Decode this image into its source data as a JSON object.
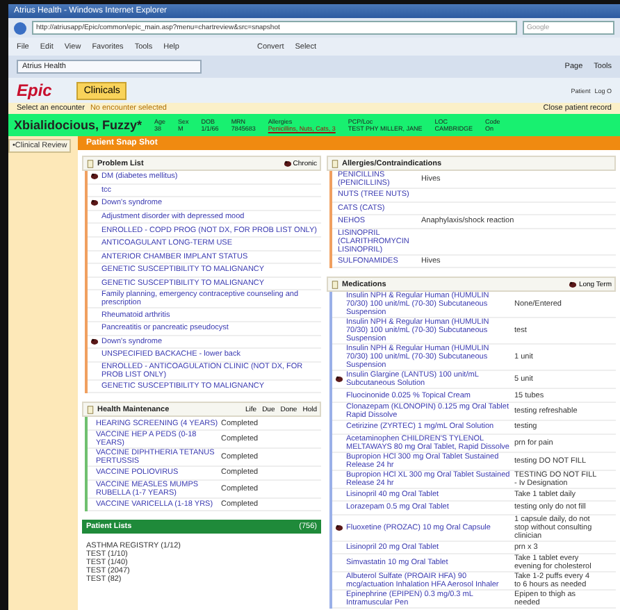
{
  "window": {
    "title": "Atrius Health - Windows Internet Explorer"
  },
  "browser": {
    "url": "http://atriusapp/Epic/common/epic_main.asp?menu=chartreview&src=snapshot",
    "search_placeholder": "Google",
    "menu": [
      "File",
      "Edit",
      "View",
      "Favorites",
      "Tools",
      "Help"
    ],
    "toolbar": [
      "Convert",
      "Select"
    ],
    "tab": "Atrius Health",
    "commands": [
      "Page",
      "Tools"
    ]
  },
  "epic": {
    "logo": "Epic",
    "activity": "Clinicals",
    "right_buttons": [
      "Patient",
      "Log O"
    ]
  },
  "encounter": {
    "label": "Select an encounter",
    "status": "No encounter selected",
    "close": "Close patient record"
  },
  "banner": {
    "name": "Xbialidocious, Fuzzy*",
    "fields": [
      {
        "label": "Age",
        "value": "38"
      },
      {
        "label": "Sex",
        "value": "M"
      },
      {
        "label": "DOB",
        "value": "1/1/66"
      },
      {
        "label": "MRN",
        "value": "7845683"
      },
      {
        "label": "Allergies",
        "value": "Penicillins, Nuts, Cats, 3",
        "alert": true
      },
      {
        "label": "PCP/Loc",
        "value": "TEST PHY MILLER, JANE",
        "alert": false
      },
      {
        "label": "LOC",
        "value": "CAMBRIDGE",
        "alert": false
      },
      {
        "label": "Code",
        "value": "On",
        "alert": false
      }
    ]
  },
  "sidebar": {
    "items": [
      {
        "label": "•Clinical Review",
        "selected": true
      }
    ]
  },
  "section_title": "Patient Snap Shot",
  "problem_list": {
    "title": "Problem List",
    "action": "Chronic",
    "items": [
      {
        "text": "DM (diabetes mellitus)",
        "chronic": true
      },
      {
        "text": "tcc",
        "chronic": false
      },
      {
        "text": "Down's syndrome",
        "chronic": true
      },
      {
        "text": "Adjustment disorder with depressed mood",
        "chronic": false
      },
      {
        "text": "ENROLLED - COPD PROG (NOT DX, FOR PROB LIST ONLY)",
        "chronic": false
      },
      {
        "text": "ANTICOAGULANT LONG-TERM USE",
        "chronic": false
      },
      {
        "text": "ANTERIOR CHAMBER IMPLANT STATUS",
        "chronic": false
      },
      {
        "text": "GENETIC SUSCEPTIBILITY TO MALIGNANCY",
        "chronic": false
      },
      {
        "text": "GENETIC SUSCEPTIBILITY TO MALIGNANCY",
        "chronic": false
      },
      {
        "text": "Family planning, emergency contraceptive counseling and prescription",
        "chronic": false
      },
      {
        "text": "Rheumatoid arthritis",
        "chronic": false
      },
      {
        "text": "Pancreatitis or pancreatic pseudocyst",
        "chronic": false
      },
      {
        "text": "Down's syndrome",
        "chronic": true
      },
      {
        "text": "UNSPECIFIED BACKACHE - lower back",
        "chronic": false
      },
      {
        "text": "ENROLLED - ANTICOAGULATION CLINIC (NOT DX, FOR PROB LIST ONLY)",
        "chronic": false
      },
      {
        "text": "GENETIC SUSCEPTIBILITY TO MALIGNANCY",
        "chronic": false
      }
    ]
  },
  "allergies": {
    "title": "Allergies/Contraindications",
    "items": [
      {
        "name": "PENICILLINS (PENICILLINS)",
        "reaction": "Hives"
      },
      {
        "name": "NUTS (TREE NUTS)"
      },
      {
        "name": "CATS (CATS)"
      },
      {
        "name": "NEHOS",
        "reaction": "Anaphylaxis/shock reaction"
      },
      {
        "name": "LISINOPRIL (CLARITHROMYCIN LISINOPRIL)"
      },
      {
        "name": "SULFONAMIDES",
        "reaction": "Hives"
      }
    ]
  },
  "medications": {
    "title": "Medications",
    "action": "Long Term",
    "items": [
      {
        "name": "Insulin NPH & Regular Human (HUMULIN 70/30) 100 unit/mL (70-30) Subcutaneous Suspension",
        "sig": "None/Entered",
        "long_term": false
      },
      {
        "name": "Insulin NPH & Regular Human (HUMULIN 70/30) 100 unit/mL (70-30) Subcutaneous Suspension",
        "sig": "test",
        "long_term": false
      },
      {
        "name": "Insulin NPH & Regular Human (HUMULIN 70/30) 100 unit/mL (70-30) Subcutaneous Suspension",
        "sig": "1 unit",
        "long_term": false
      },
      {
        "name": "Insulin Glargine (LANTUS) 100 unit/mL Subcutaneous Solution",
        "sig": "5 unit",
        "long_term": true
      },
      {
        "name": "Fluocinonide 0.025 % Topical Cream",
        "sig": "15 tubes",
        "long_term": false
      },
      {
        "name": "Clonazepam (KLONOPIN) 0.125 mg Oral Tablet Rapid Dissolve",
        "sig": "testing refreshable",
        "long_term": false
      },
      {
        "name": "Cetirizine (ZYRTEC) 1 mg/mL Oral Solution",
        "sig": "testing",
        "long_term": false
      },
      {
        "name": "Acetaminophen CHILDREN'S TYLENOL MELTAWAYS 80 mg Oral Tablet, Rapid Dissolve",
        "sig": "prn for pain",
        "long_term": false
      },
      {
        "name": "Bupropion HCl 300 mg Oral Tablet Sustained Release 24 hr",
        "sig": "testing DO NOT FILL",
        "long_term": false
      },
      {
        "name": "Bupropion HCl XL 300 mg Oral Tablet Sustained Release 24 hr",
        "sig": "TESTING DO NOT FILL - Iv Designation",
        "long_term": false
      },
      {
        "name": "Lisinopril 40 mg Oral Tablet",
        "sig": "Take 1 tablet daily",
        "long_term": false
      },
      {
        "name": "Lorazepam 0.5 mg Oral Tablet",
        "sig": "testing only do not fill",
        "long_term": false
      },
      {
        "name": "Fluoxetine (PROZAC) 10 mg Oral Capsule",
        "sig": "1 capsule daily, do not stop without consulting clinician",
        "long_term": true
      },
      {
        "name": "Lisinopril 20 mg Oral Tablet",
        "sig": "prn x 3",
        "long_term": false
      },
      {
        "name": "Simvastatin 10 mg Oral Tablet",
        "sig": "Take 1 tablet every evening for cholesterol",
        "long_term": false
      },
      {
        "name": "Albuterol Sulfate (PROAIR HFA) 90 mcg/actuation Inhalation HFA Aerosol Inhaler",
        "sig": "Take 1-2 puffs every 4 to 6 hours as needed",
        "long_term": false
      },
      {
        "name": "Epinephrine (EPIPEN) 0.3 mg/0.3 mL Intramuscular Pen",
        "sig": "Epipen to thigh as needed",
        "long_term": false
      }
    ]
  },
  "health_maintenance": {
    "title": "Health Maintenance",
    "actions": [
      "Life",
      "Due",
      "Done",
      "Hold"
    ],
    "items": [
      {
        "topic": "HEARING SCREENING (4 YEARS)",
        "status": "Completed"
      },
      {
        "topic": "VACCINE HEP A PEDS (0-18 YEARS)",
        "status": "Completed"
      },
      {
        "topic": "VACCINE DIPHTHERIA TETANUS PERTUSSIS",
        "status": "Completed"
      },
      {
        "topic": "VACCINE POLIOVIRUS",
        "status": "Completed"
      },
      {
        "topic": "VACCINE MEASLES MUMPS RUBELLA (1-7 YEARS)",
        "status": "Completed"
      },
      {
        "topic": "VACCINE VARICELLA (1-18 YRS)",
        "status": "Completed"
      }
    ]
  },
  "patient_lists": {
    "title": "Patient Lists",
    "count": "(756)",
    "items": [
      "ASTHMA REGISTRY (1/12)",
      "TEST (1/10)",
      "TEST (1/40)",
      "TEST (2047)",
      "TEST (82)"
    ]
  }
}
